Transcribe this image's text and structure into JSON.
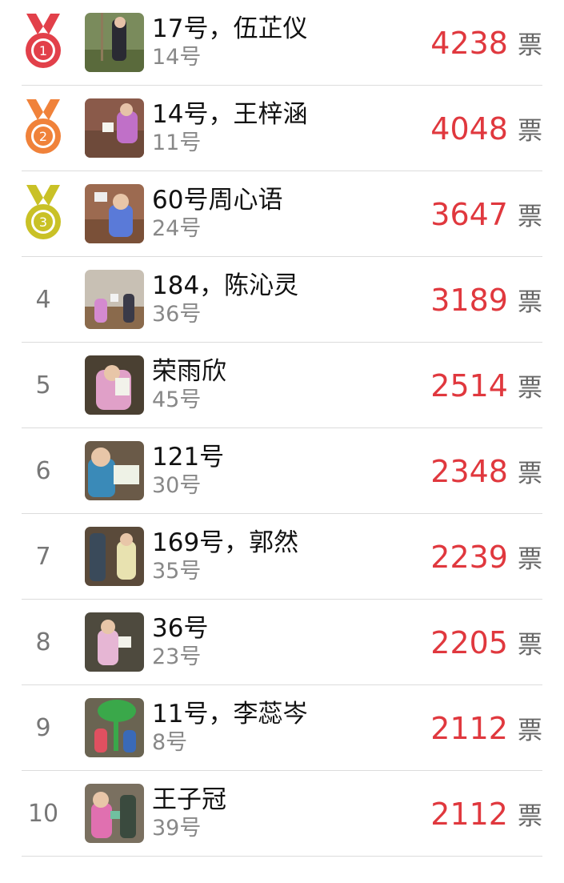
{
  "vote_unit": "票",
  "colors": {
    "accent": "#e0383e",
    "gold": "#e2404a",
    "silver": "#f0823a",
    "bronze": "#c9c126"
  },
  "entries": [
    {
      "rank": "1",
      "name": "17号，伍芷仪",
      "sub": "14号",
      "votes": "4238",
      "medal": "1"
    },
    {
      "rank": "2",
      "name": "14号，王梓涵",
      "sub": "11号",
      "votes": "4048",
      "medal": "2"
    },
    {
      "rank": "3",
      "name": "60号周心语",
      "sub": "24号",
      "votes": "3647",
      "medal": "3"
    },
    {
      "rank": "4",
      "name": "184，陈沁灵",
      "sub": "36号",
      "votes": "3189"
    },
    {
      "rank": "5",
      "name": "荣雨欣",
      "sub": "45号",
      "votes": "2514"
    },
    {
      "rank": "6",
      "name": "121号",
      "sub": "30号",
      "votes": "2348"
    },
    {
      "rank": "7",
      "name": "169号，郭然",
      "sub": "35号",
      "votes": "2239"
    },
    {
      "rank": "8",
      "name": "36号",
      "sub": "23号",
      "votes": "2205"
    },
    {
      "rank": "9",
      "name": "11号，李蕊岑",
      "sub": "8号",
      "votes": "2112"
    },
    {
      "rank": "10",
      "name": "王子冠",
      "sub": "39号",
      "votes": "2112"
    }
  ]
}
